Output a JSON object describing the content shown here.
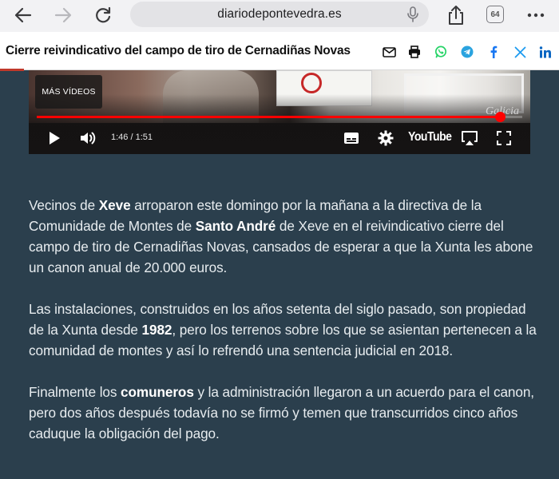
{
  "browser": {
    "url": "diariodepontevedra.es",
    "tab_count": "64"
  },
  "header": {
    "title": "Cierre reivindicativo del campo de tiro de Cernadiñas Novas",
    "share_icons": [
      "mail-icon",
      "print-icon",
      "whatsapp-icon",
      "telegram-icon",
      "facebook-icon",
      "x-icon",
      "linkedin-icon"
    ]
  },
  "video": {
    "more_videos_label": "MÁS VÍDEOS",
    "watermark": "Galicia",
    "time": "1:46 / 1:51",
    "youtube_label": "YouTube",
    "progress": 0.955,
    "accent_color": "#ff0000"
  },
  "article": {
    "paragraphs": [
      [
        {
          "t": "Vecinos de "
        },
        {
          "t": "Xeve",
          "b": true
        },
        {
          "t": " arroparon este domingo por la mañana a la directiva de la Comunidade de Montes de "
        },
        {
          "t": "Santo André",
          "b": true
        },
        {
          "t": " de Xeve en el reivindicativo cierre del campo de tiro de Cernadiñas Novas, cansados de esperar a que la Xunta les abone un canon anual de 20.000 euros."
        }
      ],
      [
        {
          "t": "Las instalaciones, construidos en los años setenta del siglo pasado, son propiedad de la Xunta desde "
        },
        {
          "t": "1982",
          "b": true
        },
        {
          "t": ", pero los terrenos sobre los que se asientan pertenecen a la comunidad de montes y así lo refrendó una sentencia judicial en 2018."
        }
      ],
      [
        {
          "t": "Finalmente los "
        },
        {
          "t": "comuneros",
          "b": true
        },
        {
          "t": " y la administración llegaron a un acuerdo para el canon, pero dos años después todavía no se firmó y temen que transcurridos cinco años caduque la obligación del pago."
        }
      ]
    ]
  }
}
